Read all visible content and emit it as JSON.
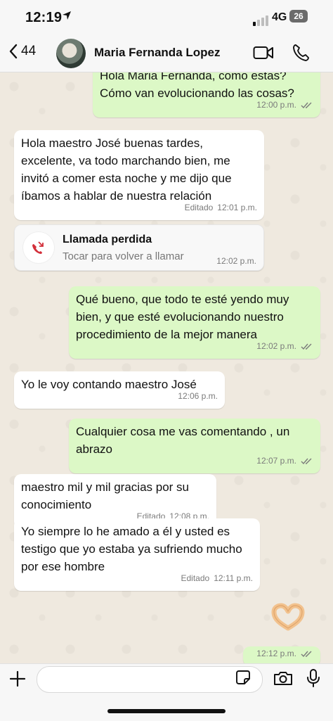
{
  "status_bar": {
    "time": "12:19",
    "network": "4G",
    "battery": "26"
  },
  "header": {
    "back_count": "44",
    "contact_name": "Maria Fernanda Lopez"
  },
  "messages": [
    {
      "dir": "out",
      "text": "Hola Maria Fernanda, como estas? Cómo van evolucionando las cosas?",
      "time": "12:00 p.m.",
      "edited": "",
      "read": true
    },
    {
      "dir": "in",
      "text": "Hola maestro José  buenas tardes, excelente, va todo marchando bien, me invitó a comer esta noche y me dijo que íbamos a hablar de nuestra relación",
      "time": "12:01 p.m.",
      "edited": "Editado"
    },
    {
      "dir": "out",
      "text": "Qué bueno, que todo te esté yendo muy bien, y que esté evolucionando nuestro procedimiento de la mejor manera",
      "time": "12:02 p.m.",
      "read": true
    },
    {
      "dir": "in",
      "text": "Yo le voy contando maestro José",
      "time": "12:06 p.m."
    },
    {
      "dir": "out",
      "text": "Cualquier cosa me vas comentando , un abrazo",
      "time": "12:07 p.m.",
      "read": true
    },
    {
      "dir": "in",
      "text": "maestro mil y mil gracias por su conocimiento",
      "time": "12:08 p.m.",
      "edited": "Editado"
    },
    {
      "dir": "in",
      "text": "Yo siempre lo he amado a él y usted es testigo que yo estaba ya sufriendo mucho por ese hombre",
      "time": "12:11 p.m.",
      "edited": "Editado"
    },
    {
      "dir": "out",
      "text": "",
      "time": "12:12 p.m.",
      "read": true
    }
  ],
  "missed_call": {
    "title": "Llamada perdida",
    "subtitle": "Tocar para volver a llamar",
    "time": "12:02 p.m."
  },
  "emoji_reply": "🫶🏼",
  "input": {
    "placeholder": ""
  },
  "colors": {
    "incoming": "#ffffff",
    "outgoing": "#dcf8c6",
    "background": "#efe9df",
    "missed_red": "#d32f3a"
  }
}
